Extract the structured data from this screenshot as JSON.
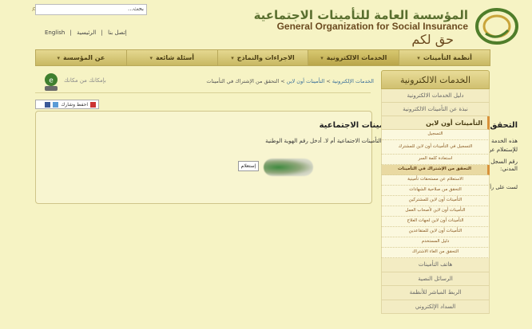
{
  "header": {
    "logo_ar": "المؤسسة العامة للتأمينات الاجتماعية",
    "logo_en": "General Organization for Social Insurance",
    "slogan": "حق لكم",
    "search_label": "بحث..."
  },
  "top_links": {
    "english": "English",
    "contact": "إتصل بنا",
    "home": "الرئيسية"
  },
  "nav": {
    "items": [
      {
        "label": "أنظمة التأمينات"
      },
      {
        "label": "الخدمات الالكترونية"
      },
      {
        "label": "الاجراءات والنماذج"
      },
      {
        "label": "أسئلة شائعة"
      },
      {
        "label": "عن المؤسسة"
      }
    ]
  },
  "eservice_caption": "بإمكانك من مكانك",
  "breadcrumb": {
    "level1": "الخدمات الإلكترونية",
    "level2": "التأمينات أون لاين",
    "level3": "التحقق من الإشتراك في التأمينات"
  },
  "share": {
    "label": "احفظ وشارك"
  },
  "main": {
    "title": "التحقق من الإشتراك في نظام التأمينات الاجتماعية",
    "description_1": "هذه الخدمة تمكنك من معرفة ما إذا كنت مشتركاً في نظام التأمينات الاجتماعية أم لا. أدخل رقم الهوية الوطنية",
    "description_2": "للإستعلام عن ذلك.",
    "field_label": "رقم السجل المدني:",
    "submit_label": "إستعلام",
    "note": "لست على رأس العمل حالياً ولديك مدة اشتراك سابقة ."
  },
  "sidebar": {
    "title": "الخدمات الالكترونية",
    "items_top": [
      {
        "label": "دليل الخدمات الالكترونية"
      },
      {
        "label": "نبذة عن التأمينات الالكترونية"
      }
    ],
    "section": "التأمينات أون لاين",
    "sub_items": [
      {
        "label": "التسجيل",
        "tall": false,
        "active": false
      },
      {
        "label": "التسجيل في التأمينات أون لاين للمشترك",
        "tall": true,
        "active": false
      },
      {
        "label": "استعادة كلمة السر",
        "tall": false,
        "active": false
      },
      {
        "label": "التحقق من الإشتراك في التأمينات",
        "tall": false,
        "active": true
      },
      {
        "label": "الاستعلام عن مستحقات تأمينية",
        "tall": false,
        "active": false
      },
      {
        "label": "التحقق من صلاحية الشهادات",
        "tall": false,
        "active": false
      },
      {
        "label": "التأمينات أون لاين للمشتركين",
        "tall": false,
        "active": false
      },
      {
        "label": "التأمينات أون لاين لأصحاب العمل",
        "tall": false,
        "active": false
      },
      {
        "label": "التأمينات أون لاين لجهات العلاج",
        "tall": false,
        "active": false
      },
      {
        "label": "التأمينات أون لاين للمتقاعدين",
        "tall": false,
        "active": false
      },
      {
        "label": "دليل المستخدم",
        "tall": false,
        "active": false
      },
      {
        "label": "التحقق من الغاء الاشتراك",
        "tall": false,
        "active": false
      }
    ],
    "items_bottom": [
      {
        "label": "هاتف التأمينات"
      },
      {
        "label": "الرسائل النصية"
      },
      {
        "label": "الربط المباشر للأنظمة"
      },
      {
        "label": "السداد الإلكتروني"
      }
    ]
  }
}
